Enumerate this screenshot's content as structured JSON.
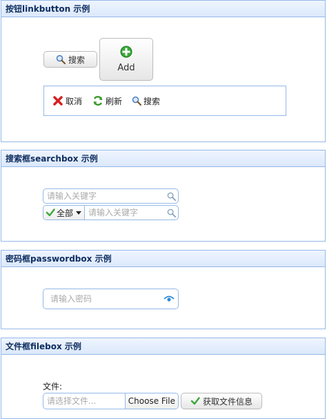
{
  "linkbutton_panel": {
    "title": "按钮linkbutton 示例",
    "search_button": {
      "label": "搜索",
      "icon": "search-icon"
    },
    "add_button": {
      "label": "Add",
      "icon": "add-icon"
    },
    "toolbar": {
      "cancel_label": "取消",
      "refresh_label": "刷新",
      "search_label": "搜索"
    }
  },
  "searchbox_panel": {
    "title": "搜索框searchbox 示例",
    "search1": {
      "placeholder": "请输入关键字"
    },
    "search2": {
      "menu_value": "全部",
      "placeholder": "请输入关键字"
    }
  },
  "passwordbox_panel": {
    "title": "密码框passwordbox 示例",
    "password": {
      "placeholder": "请输入密码"
    }
  },
  "filebox_panel": {
    "title": "文件框filebox 示例",
    "file_label": "文件:",
    "file_placeholder": "请选择文件...",
    "choose_button": "Choose File",
    "get_info_button": "获取文件信息"
  },
  "colors": {
    "border": "#95b8e7",
    "header_bg": "#e0ecff",
    "header_text": "#0e2d5f"
  }
}
